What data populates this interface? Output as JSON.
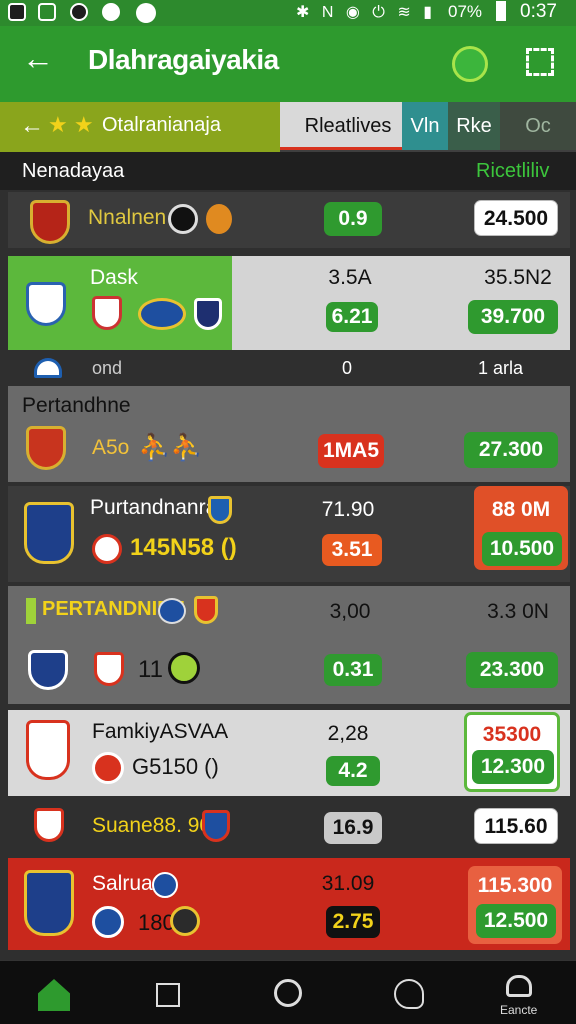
{
  "status_bar": {
    "battery": "07%",
    "time": "0:37"
  },
  "app_bar": {
    "title": "Dlahragaiyakia"
  },
  "sub_bar": {
    "league": "Otalranianaja",
    "tabs": [
      "Rleatlives",
      "Vln",
      "Rke",
      "Oc"
    ]
  },
  "list_header": {
    "left": "Nenadayaa",
    "right": "Ricetliliv"
  },
  "rows": [
    {
      "name": "Nnalnen",
      "v1": "0.9",
      "v2": "24.500"
    },
    {
      "name": "Dask",
      "top1": "3.5A",
      "top2": "35.5N2",
      "v1": "6.21",
      "v2": "39.700"
    },
    {
      "label_mid": "ond",
      "n1": "0",
      "n2": "1 arla"
    },
    {
      "section": "Pertandhne",
      "name": "A5o",
      "v1": "1MA5",
      "v2": "27.300"
    },
    {
      "name": "Purtandnanra",
      "sub": "145N58 ()",
      "top1": "71.90",
      "top2": "88 0M",
      "v1": "3.51",
      "v2": "10.500"
    },
    {
      "name": "PERTANDNIEN",
      "top1": "3,00",
      "top2": "3.3 0N",
      "sub": "11",
      "v1": "0.31",
      "v2": "23.300"
    },
    {
      "name": "FamkiyASVAA",
      "sub": "G5150 ()",
      "top1": "2,28",
      "top2": "35300",
      "v1": "4.2",
      "v2": "12.300"
    },
    {
      "name": "Suane88. 90",
      "v1": "16.9",
      "v2": "115.60"
    },
    {
      "name": "Salrua",
      "sub": "180",
      "top1": "31.09",
      "top2": "115.300",
      "v1": "2.75",
      "v2": "12.500"
    }
  ],
  "bottom_nav": {
    "last_label": "Eancte"
  },
  "colors": {
    "green": "#2e9a2e",
    "red": "#d8321e",
    "dark": "#2f2f2f"
  }
}
